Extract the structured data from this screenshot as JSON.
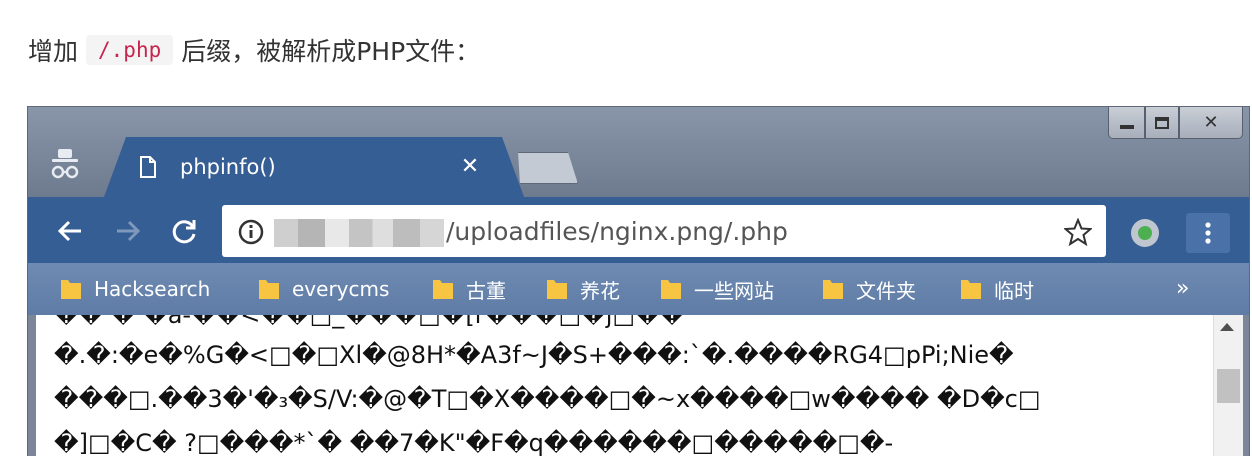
{
  "caption": {
    "before": "增加",
    "code": "/.php",
    "after": "后缀，被解析成PHP文件："
  },
  "window_controls": {
    "minimize": "minimize-icon",
    "maximize": "maximize-icon",
    "close": "✕"
  },
  "tab": {
    "title": "phpinfo()",
    "close": "✕"
  },
  "address_bar": {
    "url_visible": "/uploadfiles/nginx.png/.php"
  },
  "bookmarks": [
    {
      "label": "Hacksearch"
    },
    {
      "label": "everycms"
    },
    {
      "label": "古董"
    },
    {
      "label": "养花"
    },
    {
      "label": "一些网站"
    },
    {
      "label": "文件夹"
    },
    {
      "label": "临时"
    }
  ],
  "bookmarks_overflow": "»",
  "page_content": {
    "lines": [
      "�� �  �a-��<��□_���□�[r���□�j□��",
      "�.�:�e�%G�<□�□Xl�@8H*�A3f~J�S+���:`�.����RG4□pPi;Nie�",
      "���□.��3�'�₃�S/V:�@�T□�X����□�~x����□w���� �D�c□",
      "�]□�C� ?□���*`� ��7�K\"�F�q������□�����□�-"
    ]
  },
  "colors": {
    "tab_bg": "#355e94",
    "frame_bg": "#7b8799",
    "bookmarks_bg": "#6384ad",
    "code_text": "#c7254e"
  }
}
